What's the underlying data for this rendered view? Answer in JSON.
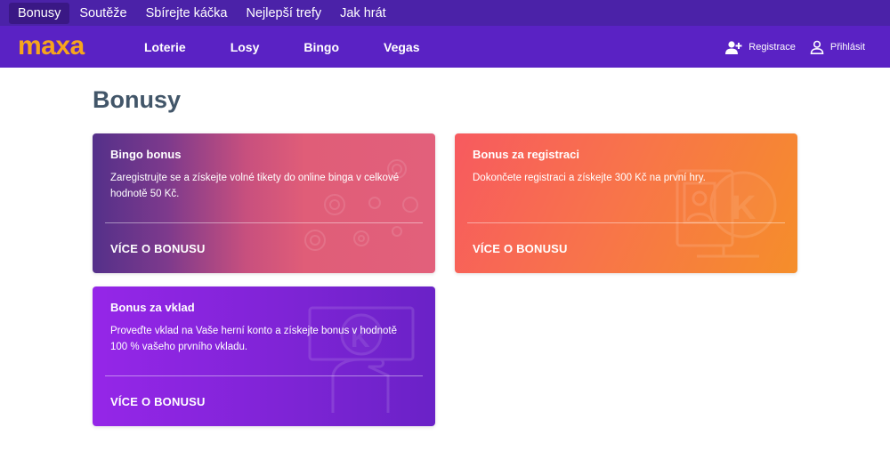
{
  "top_nav": {
    "tabs": [
      {
        "label": "Bonusy"
      },
      {
        "label": "Soutěže"
      },
      {
        "label": "Sbírejte káčka"
      },
      {
        "label": "Nejlepší trefy"
      },
      {
        "label": "Jak hrát"
      }
    ]
  },
  "header": {
    "logo": "maxa",
    "nav": [
      {
        "label": "Loterie"
      },
      {
        "label": "Losy"
      },
      {
        "label": "Bingo"
      },
      {
        "label": "Vegas"
      }
    ],
    "register_label": "Registrace",
    "login_label": "Přihlásit"
  },
  "page": {
    "title": "Bonusy"
  },
  "cards": [
    {
      "title": "Bingo bonus",
      "description": "Zaregistrujte se a získejte volné tikety do online binga v celkové hodnotě 50 Kč.",
      "link": "VÍCE O BONUSU",
      "icon": "bingo-balls-icon"
    },
    {
      "title": "Bonus za registraci",
      "description": "Dokončete registraci a získejte 300 Kč na první hry.",
      "link": "VÍCE O BONUSU",
      "icon": "registration-coin-icon"
    },
    {
      "title": "Bonus za vklad",
      "description": "Proveďte vklad na Vaše herní konto a získejte bonus v hodnotě 100 % vašeho prvního vkladu.",
      "link": "VÍCE O BONUSU",
      "icon": "deposit-hand-icon"
    }
  ],
  "colors": {
    "top_bar": "#4b22a8",
    "main_bar": "#5a22c4",
    "logo": "#f7a51c",
    "title": "#425669"
  }
}
